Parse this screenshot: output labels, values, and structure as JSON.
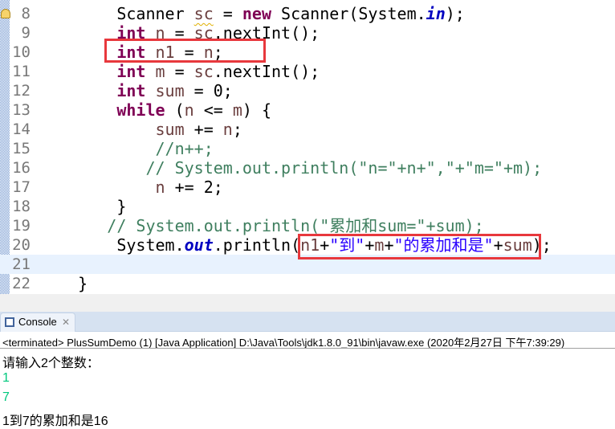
{
  "editor": {
    "current_line": 21,
    "lines": [
      {
        "num": "8",
        "indent": "        ",
        "tokens": [
          {
            "t": "Scanner ",
            "c": ""
          },
          {
            "t": "sc",
            "c": "var warn"
          },
          {
            "t": " = ",
            "c": ""
          },
          {
            "t": "new",
            "c": "kw"
          },
          {
            "t": " Scanner(System.",
            "c": ""
          },
          {
            "t": "in",
            "c": "fld"
          },
          {
            "t": ");",
            "c": ""
          }
        ]
      },
      {
        "num": "9",
        "indent": "        ",
        "tokens": [
          {
            "t": "int",
            "c": "kw"
          },
          {
            "t": " ",
            "c": ""
          },
          {
            "t": "n",
            "c": "var"
          },
          {
            "t": " = ",
            "c": ""
          },
          {
            "t": "sc",
            "c": "var"
          },
          {
            "t": ".nextInt();",
            "c": ""
          }
        ]
      },
      {
        "num": "10",
        "indent": "        ",
        "tokens": [
          {
            "t": "int",
            "c": "kw"
          },
          {
            "t": " ",
            "c": ""
          },
          {
            "t": "n1",
            "c": "var"
          },
          {
            "t": " = ",
            "c": ""
          },
          {
            "t": "n",
            "c": "var"
          },
          {
            "t": ";",
            "c": ""
          }
        ]
      },
      {
        "num": "11",
        "indent": "        ",
        "tokens": [
          {
            "t": "int",
            "c": "kw"
          },
          {
            "t": " ",
            "c": ""
          },
          {
            "t": "m",
            "c": "var"
          },
          {
            "t": " = ",
            "c": ""
          },
          {
            "t": "sc",
            "c": "var"
          },
          {
            "t": ".nextInt();",
            "c": ""
          }
        ]
      },
      {
        "num": "12",
        "indent": "        ",
        "tokens": [
          {
            "t": "int",
            "c": "kw"
          },
          {
            "t": " ",
            "c": ""
          },
          {
            "t": "sum",
            "c": "var"
          },
          {
            "t": " = 0;",
            "c": ""
          }
        ]
      },
      {
        "num": "13",
        "indent": "        ",
        "tokens": [
          {
            "t": "while",
            "c": "kw"
          },
          {
            "t": " (",
            "c": ""
          },
          {
            "t": "n",
            "c": "var"
          },
          {
            "t": " <= ",
            "c": ""
          },
          {
            "t": "m",
            "c": "var"
          },
          {
            "t": ") {",
            "c": ""
          }
        ]
      },
      {
        "num": "14",
        "indent": "            ",
        "tokens": [
          {
            "t": "sum",
            "c": "var"
          },
          {
            "t": " += ",
            "c": ""
          },
          {
            "t": "n",
            "c": "var"
          },
          {
            "t": ";",
            "c": ""
          }
        ]
      },
      {
        "num": "15",
        "indent": "            ",
        "tokens": [
          {
            "t": "//n++;",
            "c": "cm"
          }
        ]
      },
      {
        "num": "16",
        "indent": "           ",
        "tokens": [
          {
            "t": "// System.out.println(\"n=\"+n+\",\"+\"m=\"+m);",
            "c": "cm"
          }
        ]
      },
      {
        "num": "17",
        "indent": "            ",
        "tokens": [
          {
            "t": "n",
            "c": "var"
          },
          {
            "t": " += 2;",
            "c": ""
          }
        ]
      },
      {
        "num": "18",
        "indent": "        ",
        "tokens": [
          {
            "t": "}",
            "c": ""
          }
        ]
      },
      {
        "num": "19",
        "indent": "       ",
        "tokens": [
          {
            "t": "// System.out.println(\"累加和sum=\"+sum);",
            "c": "cm"
          }
        ]
      },
      {
        "num": "20",
        "indent": "        ",
        "tokens": [
          {
            "t": "System.",
            "c": ""
          },
          {
            "t": "out",
            "c": "fld"
          },
          {
            "t": ".println(",
            "c": ""
          },
          {
            "t": "n1",
            "c": "var"
          },
          {
            "t": "+",
            "c": ""
          },
          {
            "t": "\"到\"",
            "c": "str"
          },
          {
            "t": "+",
            "c": ""
          },
          {
            "t": "m",
            "c": "var"
          },
          {
            "t": "+",
            "c": ""
          },
          {
            "t": "\"的累加和是\"",
            "c": "str"
          },
          {
            "t": "+",
            "c": ""
          },
          {
            "t": "sum",
            "c": "var"
          },
          {
            "t": ");",
            "c": ""
          }
        ]
      },
      {
        "num": "21",
        "indent": "",
        "tokens": []
      },
      {
        "num": "22",
        "indent": "    ",
        "tokens": [
          {
            "t": "}",
            "c": ""
          }
        ]
      }
    ]
  },
  "console": {
    "tab_label": "Console",
    "close_glyph": "✕",
    "status": "<terminated> PlusSumDemo (1) [Java Application] D:\\Java\\Tools\\jdk1.8.0_91\\bin\\javaw.exe (2020年2月27日 下午7:39:29)",
    "output": [
      {
        "text": "请输入2个整数：",
        "type": "out"
      },
      {
        "text": "1",
        "type": "in"
      },
      {
        "text": "7",
        "type": "in"
      },
      {
        "text": "1到7的累加和是16",
        "type": "out"
      }
    ]
  },
  "colors": {
    "highlight_box": "#e8383d",
    "keyword": "#7f0055",
    "string": "#2a00ff",
    "comment": "#3f7f5f",
    "stdin": "#00c87d"
  }
}
